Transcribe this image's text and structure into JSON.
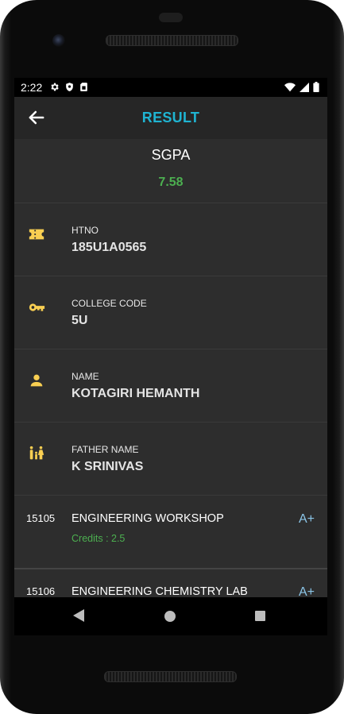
{
  "status": {
    "time": "2:22"
  },
  "appbar": {
    "title": "RESULT"
  },
  "summary": {
    "label": "SGPA",
    "value": "7.58"
  },
  "details": [
    {
      "label": "HTNO",
      "value": "185U1A0565",
      "icon": "ticket-icon"
    },
    {
      "label": "COLLEGE CODE",
      "value": "5U",
      "icon": "key-icon"
    },
    {
      "label": "NAME",
      "value": "KOTAGIRI HEMANTH",
      "icon": "person-icon"
    },
    {
      "label": "FATHER NAME",
      "value": "K SRINIVAS",
      "icon": "family-icon"
    }
  ],
  "subjects": [
    {
      "code": "15105",
      "name": "ENGINEERING WORKSHOP",
      "credits": "Credits : 2.5",
      "grade": "A+"
    },
    {
      "code": "15106",
      "name": "ENGINEERING CHEMISTRY LAB",
      "grade": "A+"
    }
  ],
  "colors": {
    "accent": "#1fb4d2",
    "positive": "#4caf50",
    "icon": "#f9cf52",
    "grade": "#8cc6e8"
  }
}
